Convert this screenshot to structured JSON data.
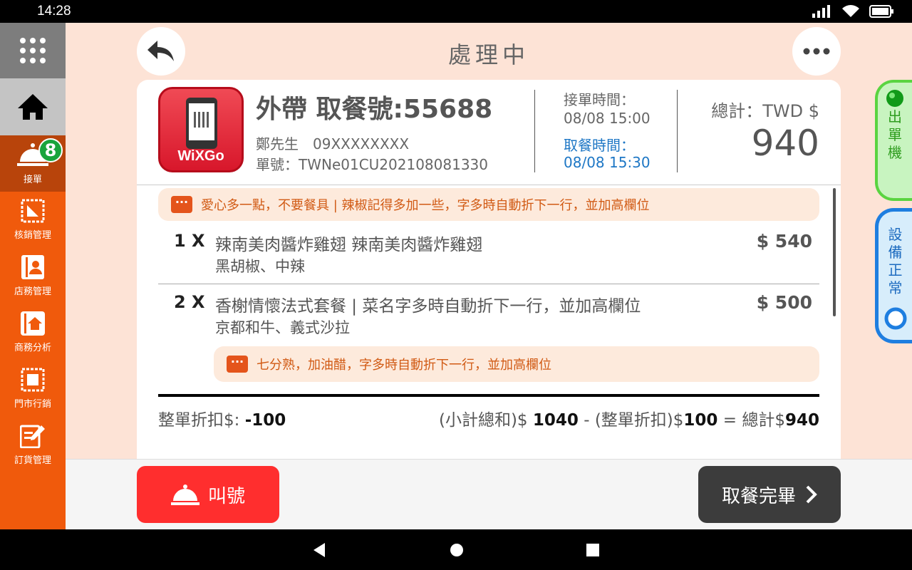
{
  "status_bar": {
    "time": "14:28"
  },
  "sidebar": {
    "items": [
      {
        "label": "接單",
        "badge": "8"
      },
      {
        "label": "核銷管理"
      },
      {
        "label": "店務管理"
      },
      {
        "label": "商務分析"
      },
      {
        "label": "門市行銷"
      },
      {
        "label": "訂貨管理"
      }
    ]
  },
  "header": {
    "title": "處理中"
  },
  "order": {
    "logo_text": "WiXGo",
    "title": "外帶 取餐號:55688",
    "customer": "鄭先生　09XXXXXXXX",
    "order_no": "單號：TWNe01CU202108081330",
    "received_label": "接單時間：",
    "received_time": "08/08 15:00",
    "pickup_label": "取餐時間：",
    "pickup_time": "08/08 15:30",
    "total_label": "總計：TWD $",
    "total_value": "940"
  },
  "order_note": "愛心多一點，不要餐具 | 辣椒記得多加一些，字多時自動折下一行，並加高欄位",
  "items": [
    {
      "qty": "1 X",
      "name": "辣南美肉醬炸雞翅 辣南美肉醬炸雞翅",
      "options": "黑胡椒、中辣",
      "price": "$ 540"
    },
    {
      "qty": "2 X",
      "name": "香榭情懷法式套餐 | 菜名字多時自動折下一行，並加高欄位",
      "options": "京都和牛、義式沙拉",
      "price": "$ 500",
      "note": "七分熟，加油醋，字多時自動折下一行，並加高欄位"
    }
  ],
  "summary": {
    "discount_label": "整單折扣$:",
    "discount_value": "-100",
    "subtotal_label": "(小計總和)$",
    "subtotal_value": "1040",
    "minus": "-",
    "discount_label2": "(整單折扣)$",
    "discount_value2": "100",
    "equals": "=",
    "total_label": "總計$",
    "total_value": "940"
  },
  "buttons": {
    "call": "叫號",
    "done": "取餐完畢"
  },
  "side": {
    "printer": [
      "出",
      "單",
      "機"
    ],
    "device": [
      "設",
      "備",
      "正",
      "常"
    ]
  },
  "colors": {
    "accent": "#f05a0c",
    "call": "#ff2e2e",
    "done": "#3c3c3c",
    "printer": "#5ad441",
    "device": "#1e7ee0"
  }
}
